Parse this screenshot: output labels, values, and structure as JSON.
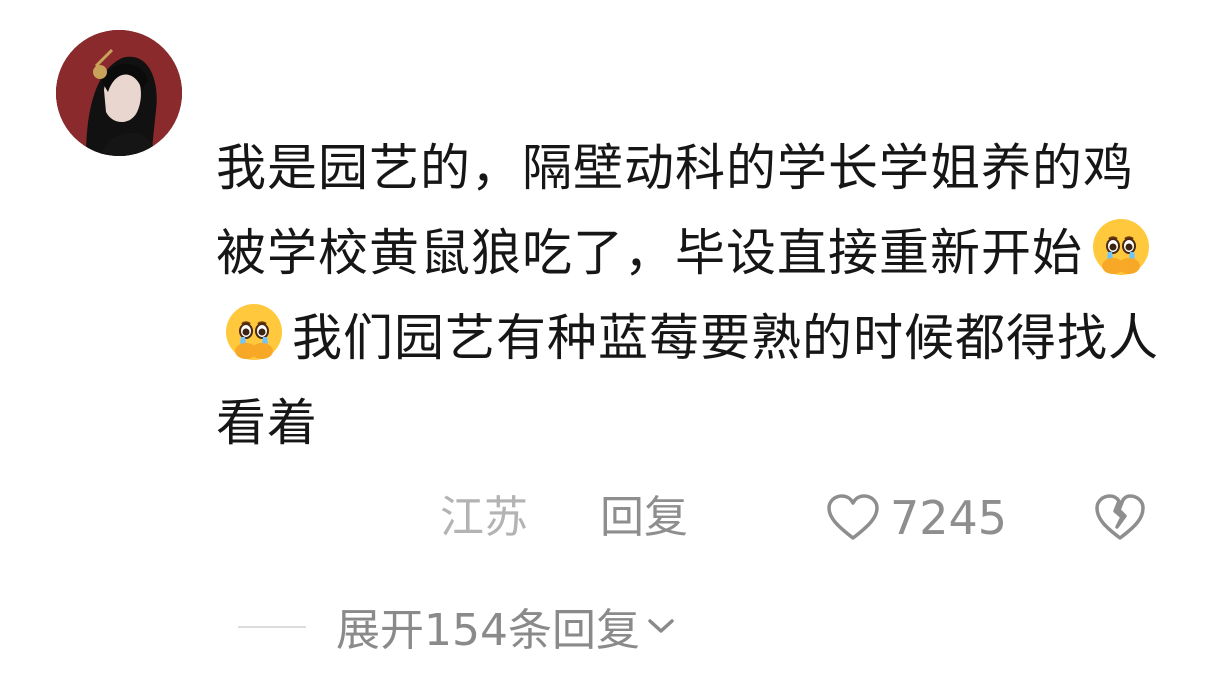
{
  "comment": {
    "avatar_alt": "avatar",
    "text_parts": [
      "我是园艺的，隔壁动科的学长学姐养的鸡被学校黄鼠狼吃了，毕设直接重新开始",
      "我们园艺有种蓝莓要熟的时候都得找人看着"
    ],
    "emoji_icons": [
      "crying-face-icon",
      "crying-face-icon"
    ],
    "location": "江苏",
    "reply_label": "回复",
    "like_count": "7245"
  },
  "expand": {
    "label": "展开154条回复"
  },
  "colors": {
    "text": "#161616",
    "meta": "#8e8e8e",
    "location": "#b3b3b3",
    "avatar_bg": "#6b1e22"
  }
}
